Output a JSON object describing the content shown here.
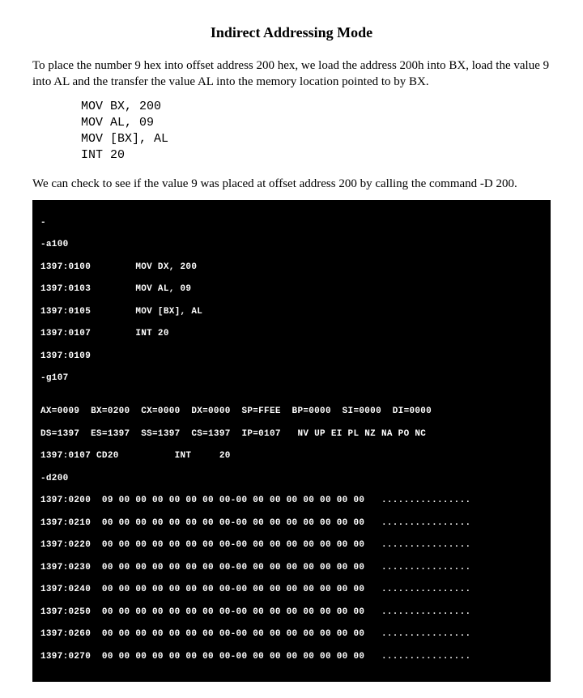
{
  "title": "Indirect Addressing Mode",
  "intro": "To place the number 9 hex into offset address 200 hex, we load the address 200h into BX, load the value 9 into AL and the transfer the value AL into the memory location pointed to by BX.",
  "asm": {
    "l1": "MOV BX, 200",
    "l2": "MOV AL, 09",
    "l3": "MOV [BX], AL",
    "l4": "INT 20"
  },
  "check": "We can check to see if the value 9 was placed at offset address 200 by calling the command -D 200.",
  "term": {
    "t00": "-",
    "t01": "-a100",
    "t02": "1397:0100        MOV DX, 200",
    "t03": "1397:0103        MOV AL, 09",
    "t04": "1397:0105        MOV [BX], AL",
    "t05": "1397:0107        INT 20",
    "t06": "1397:0109",
    "t07": "-g107",
    "t08": "",
    "t09": "AX=0009  BX=0200  CX=0000  DX=0000  SP=FFEE  BP=0000  SI=0000  DI=0000",
    "t10": "DS=1397  ES=1397  SS=1397  CS=1397  IP=0107   NV UP EI PL NZ NA PO NC",
    "t11": "1397:0107 CD20          INT     20",
    "t12": "-d200",
    "t13": "1397:0200  09 00 00 00 00 00 00 00-00 00 00 00 00 00 00 00   ................",
    "t14": "1397:0210  00 00 00 00 00 00 00 00-00 00 00 00 00 00 00 00   ................",
    "t15": "1397:0220  00 00 00 00 00 00 00 00-00 00 00 00 00 00 00 00   ................",
    "t16": "1397:0230  00 00 00 00 00 00 00 00-00 00 00 00 00 00 00 00   ................",
    "t17": "1397:0240  00 00 00 00 00 00 00 00-00 00 00 00 00 00 00 00   ................",
    "t18": "1397:0250  00 00 00 00 00 00 00 00-00 00 00 00 00 00 00 00   ................",
    "t19": "1397:0260  00 00 00 00 00 00 00 00-00 00 00 00 00 00 00 00   ................",
    "t20": "1397:0270  00 00 00 00 00 00 00 00-00 00 00 00 00 00 00 00   ................"
  }
}
